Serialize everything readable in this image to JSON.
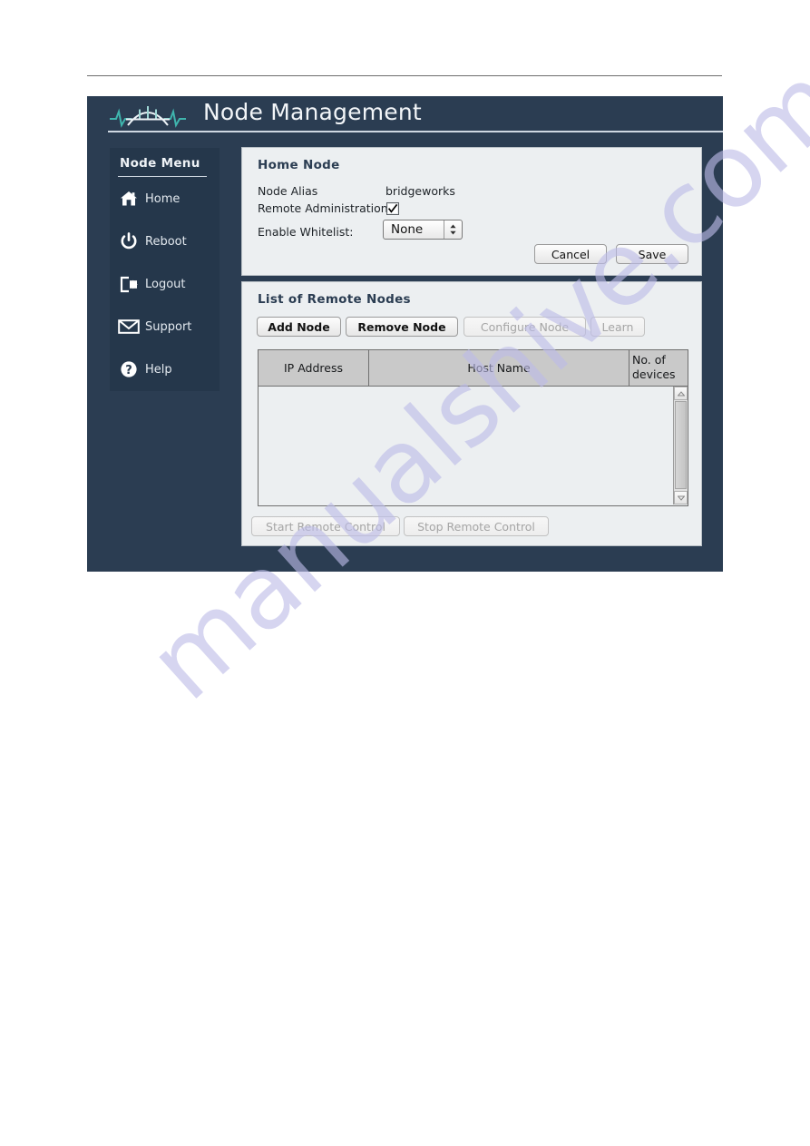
{
  "app": {
    "title": "Node Management",
    "logo_icon": "bridge-waveform-logo"
  },
  "sidebar": {
    "heading": "Node Menu",
    "items": [
      {
        "label": "Home",
        "icon": "home-icon"
      },
      {
        "label": "Reboot",
        "icon": "power-icon"
      },
      {
        "label": "Logout",
        "icon": "logout-icon"
      },
      {
        "label": "Support",
        "icon": "envelope-icon"
      },
      {
        "label": "Help",
        "icon": "question-circle-icon"
      }
    ]
  },
  "home_node": {
    "title": "Home Node",
    "node_alias_label": "Node Alias",
    "node_alias_value": "bridgeworks",
    "remote_admin_label": "Remote Administration",
    "remote_admin_checked": true,
    "whitelist_label": "Enable Whitelist:",
    "whitelist_value": "None",
    "whitelist_options": [
      "None"
    ],
    "cancel_label": "Cancel",
    "save_label": "Save"
  },
  "remote_nodes": {
    "title": "List of Remote Nodes",
    "toolbar": [
      {
        "label": "Add Node",
        "enabled": true
      },
      {
        "label": "Remove Node",
        "enabled": true
      },
      {
        "label": "Configure Node",
        "enabled": false
      },
      {
        "label": "Learn",
        "enabled": false
      }
    ],
    "columns": [
      "IP Address",
      "Host Name",
      "No. of devices"
    ],
    "rows": [],
    "footer": [
      {
        "label": "Start Remote Control",
        "enabled": false
      },
      {
        "label": "Stop Remote Control",
        "enabled": false
      }
    ]
  },
  "watermark": {
    "text": "manualshive.com"
  },
  "colors": {
    "window_bg": "#2b3d52",
    "sidebar_bg": "#25374b",
    "panel_bg": "#eceff1",
    "accent_teal": "#3fb5ad",
    "header_text": "#f2f5f8"
  }
}
